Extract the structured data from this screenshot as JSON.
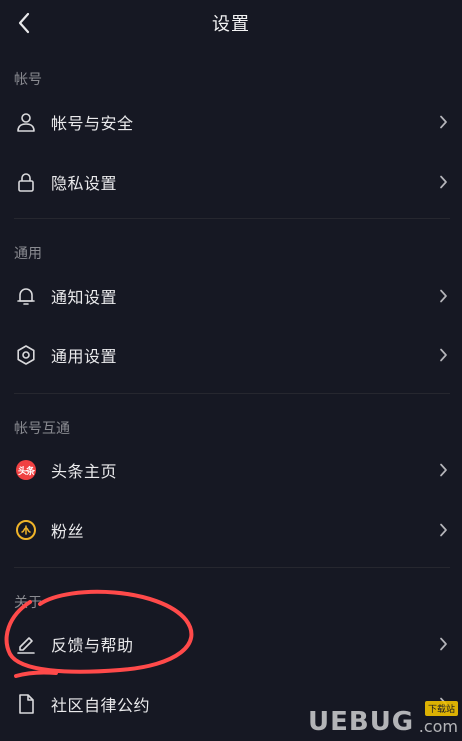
{
  "header": {
    "title": "设置",
    "back_icon": "chevron-left-icon"
  },
  "sections": [
    {
      "label": "帐号",
      "items": [
        {
          "label": "帐号与安全",
          "icon": "user-icon"
        },
        {
          "label": "隐私设置",
          "icon": "lock-icon"
        }
      ]
    },
    {
      "label": "通用",
      "items": [
        {
          "label": "通知设置",
          "icon": "bell-icon"
        },
        {
          "label": "通用设置",
          "icon": "gear-icon"
        }
      ]
    },
    {
      "label": "帐号互通",
      "items": [
        {
          "label": "头条主页",
          "icon": "toutiao-logo-icon",
          "badge_text": "头条"
        },
        {
          "label": "粉丝",
          "icon": "fans-icon"
        }
      ]
    },
    {
      "label": "关于",
      "items": [
        {
          "label": "反馈与帮助",
          "icon": "pencil-icon"
        },
        {
          "label": "社区自律公约",
          "icon": "document-icon"
        }
      ]
    }
  ],
  "annotation": {
    "color": "#ff4a4a"
  },
  "colors": {
    "background": "#161823",
    "text": "#eaeaec",
    "section_label": "#8a8b91",
    "divider": "#26272f",
    "toutiao_red": "#f04142",
    "fans_gold": "#f0b429"
  },
  "watermark": {
    "text": "UEBUG",
    "tag": "下载站",
    "suffix": ".com"
  }
}
